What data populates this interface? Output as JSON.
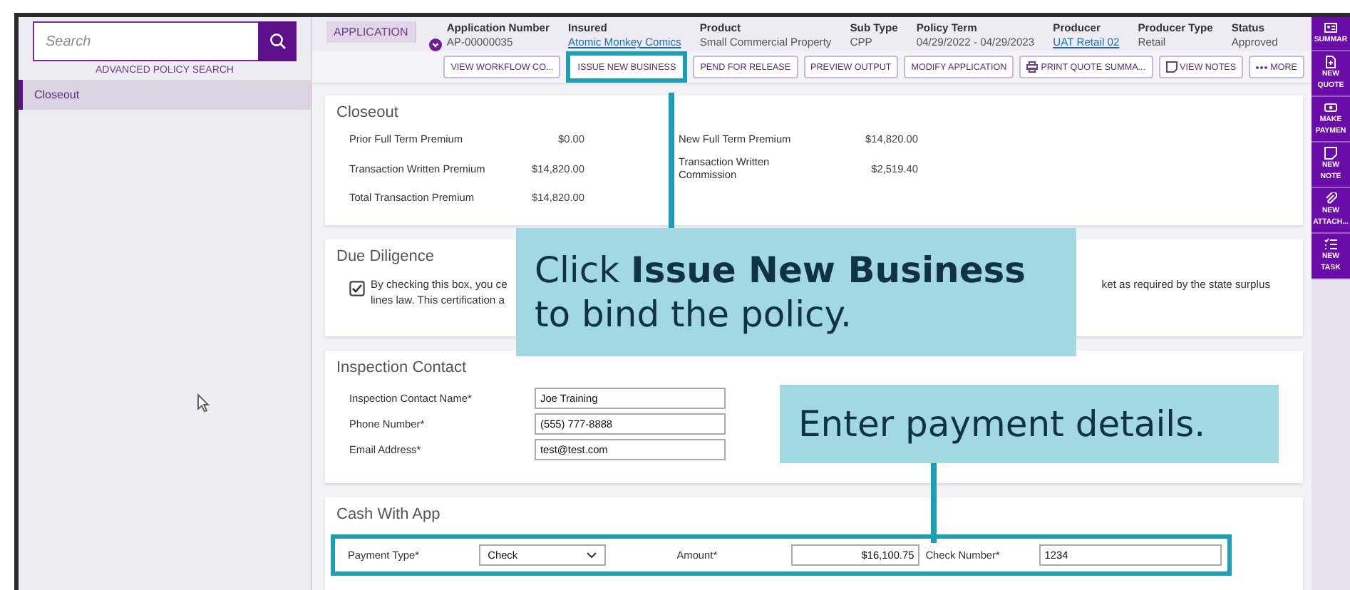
{
  "sidebar": {
    "search": {
      "placeholder": "Search"
    },
    "advanced_search": "ADVANCED POLICY SEARCH",
    "items": [
      {
        "label": "Closeout",
        "selected": true
      }
    ]
  },
  "header": {
    "badge": "APPLICATION",
    "fields": [
      {
        "label": "Application Number",
        "value": "AP-00000035",
        "link": false
      },
      {
        "label": "Insured",
        "value": "Atomic Monkey Comics",
        "link": true
      },
      {
        "label": "Product",
        "value": "Small Commercial Property",
        "link": false
      },
      {
        "label": "Sub Type",
        "value": "CPP",
        "link": false
      },
      {
        "label": "Policy Term",
        "value": "04/29/2022 - 04/29/2023",
        "link": false
      },
      {
        "label": "Producer",
        "value": "UAT Retail 02",
        "link": true
      },
      {
        "label": "Producer Type",
        "value": "Retail",
        "link": false
      },
      {
        "label": "Status",
        "value": "Approved",
        "link": false
      }
    ]
  },
  "toolbar": [
    {
      "label": "VIEW WORKFLOW CO...",
      "kind": "plain",
      "highlighted": false
    },
    {
      "label": "ISSUE NEW BUSINESS",
      "kind": "plain",
      "highlighted": true
    },
    {
      "label": "PEND FOR RELEASE",
      "kind": "plain",
      "highlighted": false
    },
    {
      "label": "PREVIEW OUTPUT",
      "kind": "plain",
      "highlighted": false
    },
    {
      "label": "MODIFY APPLICATION",
      "kind": "plain",
      "highlighted": false
    },
    {
      "label": "PRINT QUOTE SUMMA...",
      "kind": "print",
      "highlighted": false
    },
    {
      "label": "VIEW NOTES",
      "kind": "note",
      "highlighted": false
    },
    {
      "label": "MORE",
      "kind": "more",
      "highlighted": false
    }
  ],
  "closeout": {
    "title": "Closeout",
    "rows": [
      {
        "label": "Prior Full Term Premium",
        "value": "$0.00",
        "label_2": "New Full Term Premium",
        "value_2": "$14,820.00"
      },
      {
        "label": "Transaction Written Premium",
        "value": "$14,820.00",
        "label_2": "Transaction Written Commission",
        "value_2": "$2,519.40"
      },
      {
        "label": "Total Transaction Premium",
        "value": "$14,820.00"
      }
    ]
  },
  "due_diligence": {
    "title": "Due Diligence",
    "checked": true,
    "text_parts": [
      "By checking this box, you ce",
      "ket as required by the state surplus",
      "lines law. This certification a"
    ]
  },
  "inspection_contact": {
    "title": "Inspection Contact",
    "fields": [
      {
        "label": "Inspection Contact Name*",
        "value": "Joe Training"
      },
      {
        "label": "Phone Number*",
        "value": "(555) 777-8888"
      },
      {
        "label": "Email Address*",
        "value": "test@test.com"
      }
    ]
  },
  "cash_with_app": {
    "title": "Cash With App",
    "highlighted": true,
    "payment_type": {
      "label": "Payment Type*",
      "value": "Check"
    },
    "amount": {
      "label": "Amount*",
      "value": "$16,100.75"
    },
    "check_number": {
      "label": "Check Number*",
      "value": "1234"
    }
  },
  "callouts": [
    {
      "kind": "toolbar",
      "text": "Click **Issue New Business**\nto bind the policy."
    },
    {
      "kind": "payment",
      "text": "Enter payment details."
    }
  ],
  "rail": [
    {
      "kind": "summary",
      "lines": [
        "SUMMAR"
      ]
    },
    {
      "kind": "quote",
      "lines": [
        "NEW",
        "QUOTE"
      ]
    },
    {
      "kind": "payment",
      "lines": [
        "MAKE",
        "PAYMEN"
      ]
    },
    {
      "kind": "note",
      "lines": [
        "NEW",
        "NOTE"
      ]
    },
    {
      "kind": "attach",
      "lines": [
        "NEW",
        "ATTACH..."
      ]
    },
    {
      "kind": "task",
      "lines": [
        "NEW",
        "TASK"
      ]
    }
  ]
}
